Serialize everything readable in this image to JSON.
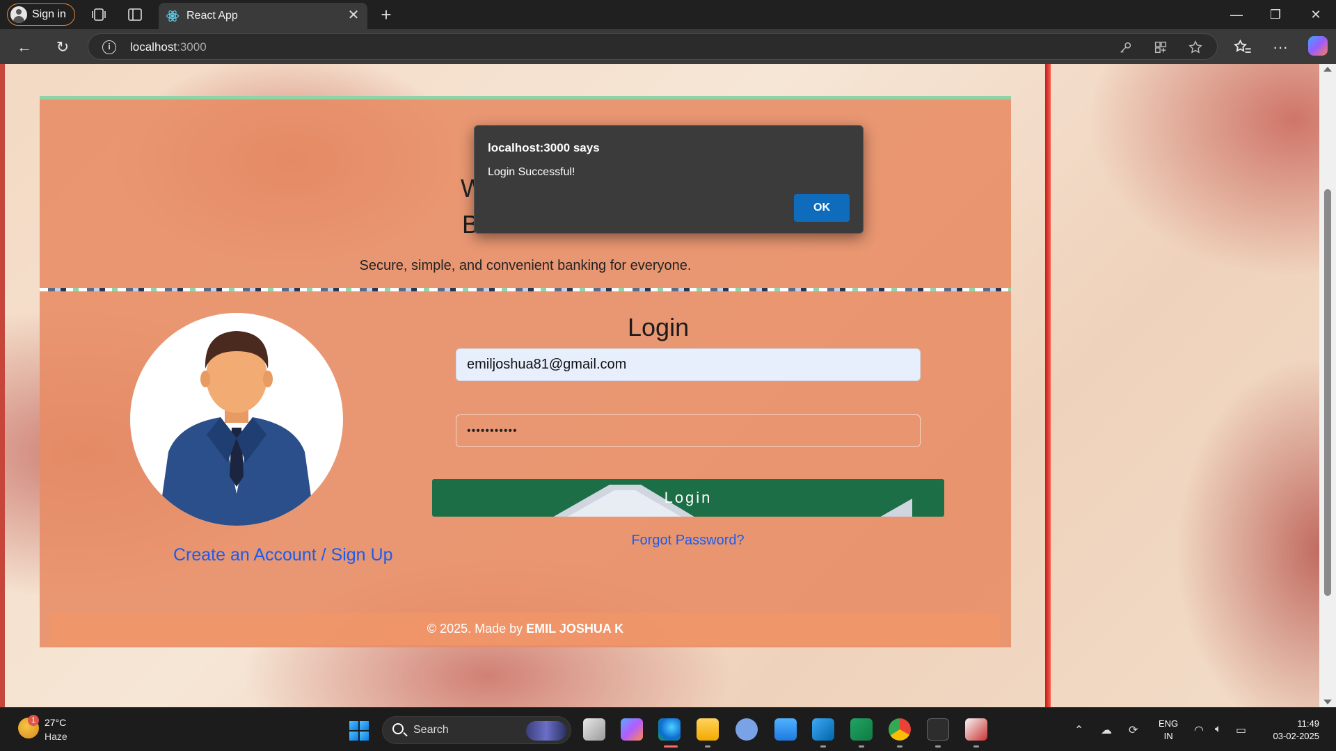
{
  "browser": {
    "signin_label": "Sign in",
    "tab_title": "React App",
    "url_host": "localhost",
    "url_port": ":3000"
  },
  "page": {
    "heading_partial": "W",
    "heading": "BAD BANK",
    "tagline": "Secure, simple, and convenient banking for everyone.",
    "signup_link": "Create an Account / Sign Up",
    "login_title": "Login",
    "email_value": "emiljoshua81@gmail.com",
    "password_value": "•••••••••••",
    "login_button": "Login",
    "forgot_link": "Forgot Password?",
    "footer_prefix": "© 2025. Made by ",
    "footer_author": "EMIL JOSHUA K"
  },
  "dialog": {
    "title": "localhost:3000 says",
    "message": "Login Successful!",
    "ok_label": "OK"
  },
  "taskbar": {
    "weather_badge": "1",
    "temperature": "27°C",
    "condition": "Haze",
    "search_label": "Search",
    "lang_line1": "ENG",
    "lang_line2": "IN",
    "time": "11:49",
    "date": "03-02-2025",
    "apps": [
      "task-view",
      "copilot",
      "edge",
      "file-explorer",
      "r-app",
      "notepad",
      "vscode",
      "excel",
      "chrome",
      "terminal",
      "snipping-tool"
    ]
  },
  "colors": {
    "accent_green": "#1b6e46",
    "link_blue": "#1a5cf0",
    "dialog_button": "#0f6cbd"
  }
}
